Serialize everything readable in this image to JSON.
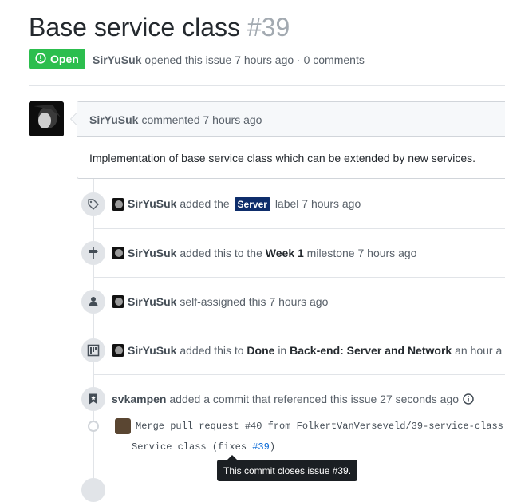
{
  "issue": {
    "title": "Base service class",
    "number": "#39",
    "state": "Open",
    "author": "SirYuSuk",
    "opened_text": "opened this issue 7 hours ago · 0 comments"
  },
  "comment": {
    "author": "SirYuSuk",
    "time": "commented 7 hours ago",
    "body": "Implementation of base service class which can be extended by new services."
  },
  "events": {
    "label": {
      "actor": "SirYuSuk",
      "pre": "added the",
      "label": "Server",
      "post": "label 7 hours ago",
      "icon": "tag-icon"
    },
    "milestone": {
      "actor": "SirYuSuk",
      "pre": "added this to the",
      "milestone": "Week 1",
      "post": "milestone 7 hours ago",
      "icon": "milestone-icon"
    },
    "assign": {
      "actor": "SirYuSuk",
      "text": "self-assigned this 7 hours ago",
      "icon": "person-icon"
    },
    "project": {
      "actor": "SirYuSuk",
      "pre": "added this to",
      "column": "Done",
      "mid": "in",
      "project": "Back-end: Server and Network",
      "post": "an hour a",
      "icon": "project-icon"
    },
    "reference": {
      "actor": "svkampen",
      "text": "added a commit that referenced this issue 27 seconds ago",
      "icon": "bookmark-icon"
    }
  },
  "commit": {
    "message": "Merge pull request #40 from FolkertVanVerseveld/39-service-class",
    "ellipsis": "…",
    "desc_pre": "Service class (fixes ",
    "desc_link": "#39",
    "desc_post": ")"
  },
  "tooltip": "This commit closes issue #39.",
  "colors": {
    "open_green": "#2cbe4e",
    "label_server": "#0e2d6b",
    "link": "#0366d6"
  }
}
